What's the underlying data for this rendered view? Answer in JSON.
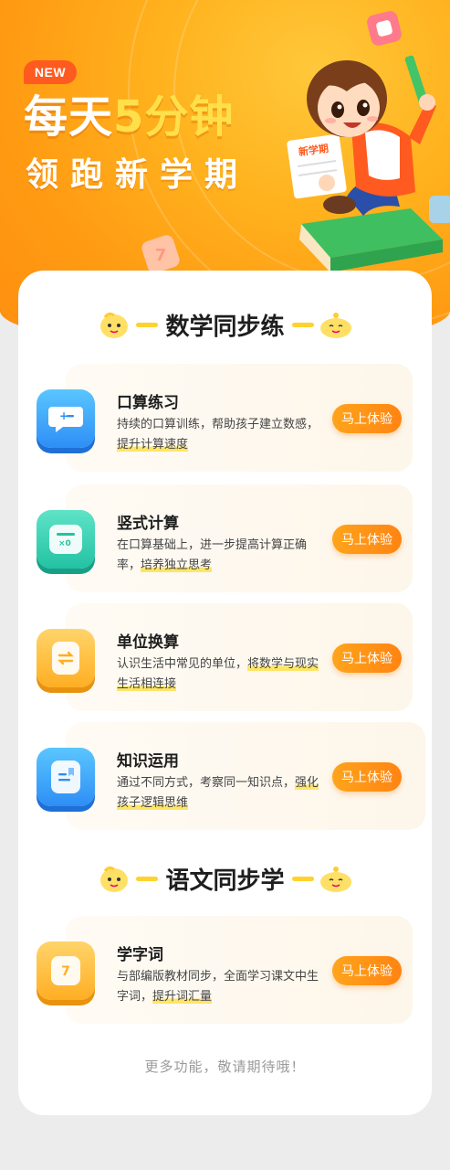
{
  "hero": {
    "badge": "NEW",
    "headline_pre": "每天",
    "headline_highlight": "5分钟",
    "subline": "领跑新学期",
    "book_sign": "新学期"
  },
  "math_section": {
    "title": "数学同步练",
    "items": [
      {
        "title": "口算练习",
        "desc_plain": "持续的口算训练，帮助孩子建立数感，",
        "desc_mark": "提升计算速度",
        "button": "马上体验",
        "icon": "chat-bubble-icon",
        "color": "#2e8ef5"
      },
      {
        "title": "竖式计算",
        "desc_plain": "在口算基础上，进一步提高计算正确率，",
        "desc_mark": "培养独立思考",
        "button": "马上体验",
        "icon": "calculator-icon",
        "color": "#23c2a3"
      },
      {
        "title": "单位换算",
        "desc_plain": "认识生活中常见的单位，",
        "desc_mark": "将数学与现实生活相连接",
        "button": "马上体验",
        "icon": "exchange-icon",
        "color": "#ffae23"
      },
      {
        "title": "知识运用",
        "desc_plain": "通过不同方式，考察同一知识点，",
        "desc_mark": "强化孩子逻辑思维",
        "button": "马上体验",
        "icon": "book-icon",
        "color": "#2e8ef5"
      }
    ]
  },
  "chinese_section": {
    "title": "语文同步学",
    "items": [
      {
        "title": "学字词",
        "desc_plain": "与部编版教材同步，全面学习课文中生字词，",
        "desc_mark": "提升词汇量",
        "button": "马上体验",
        "icon": "character-card-icon",
        "color": "#ffae23"
      }
    ]
  },
  "footer": {
    "note": "更多功能，敬请期待哦！"
  }
}
